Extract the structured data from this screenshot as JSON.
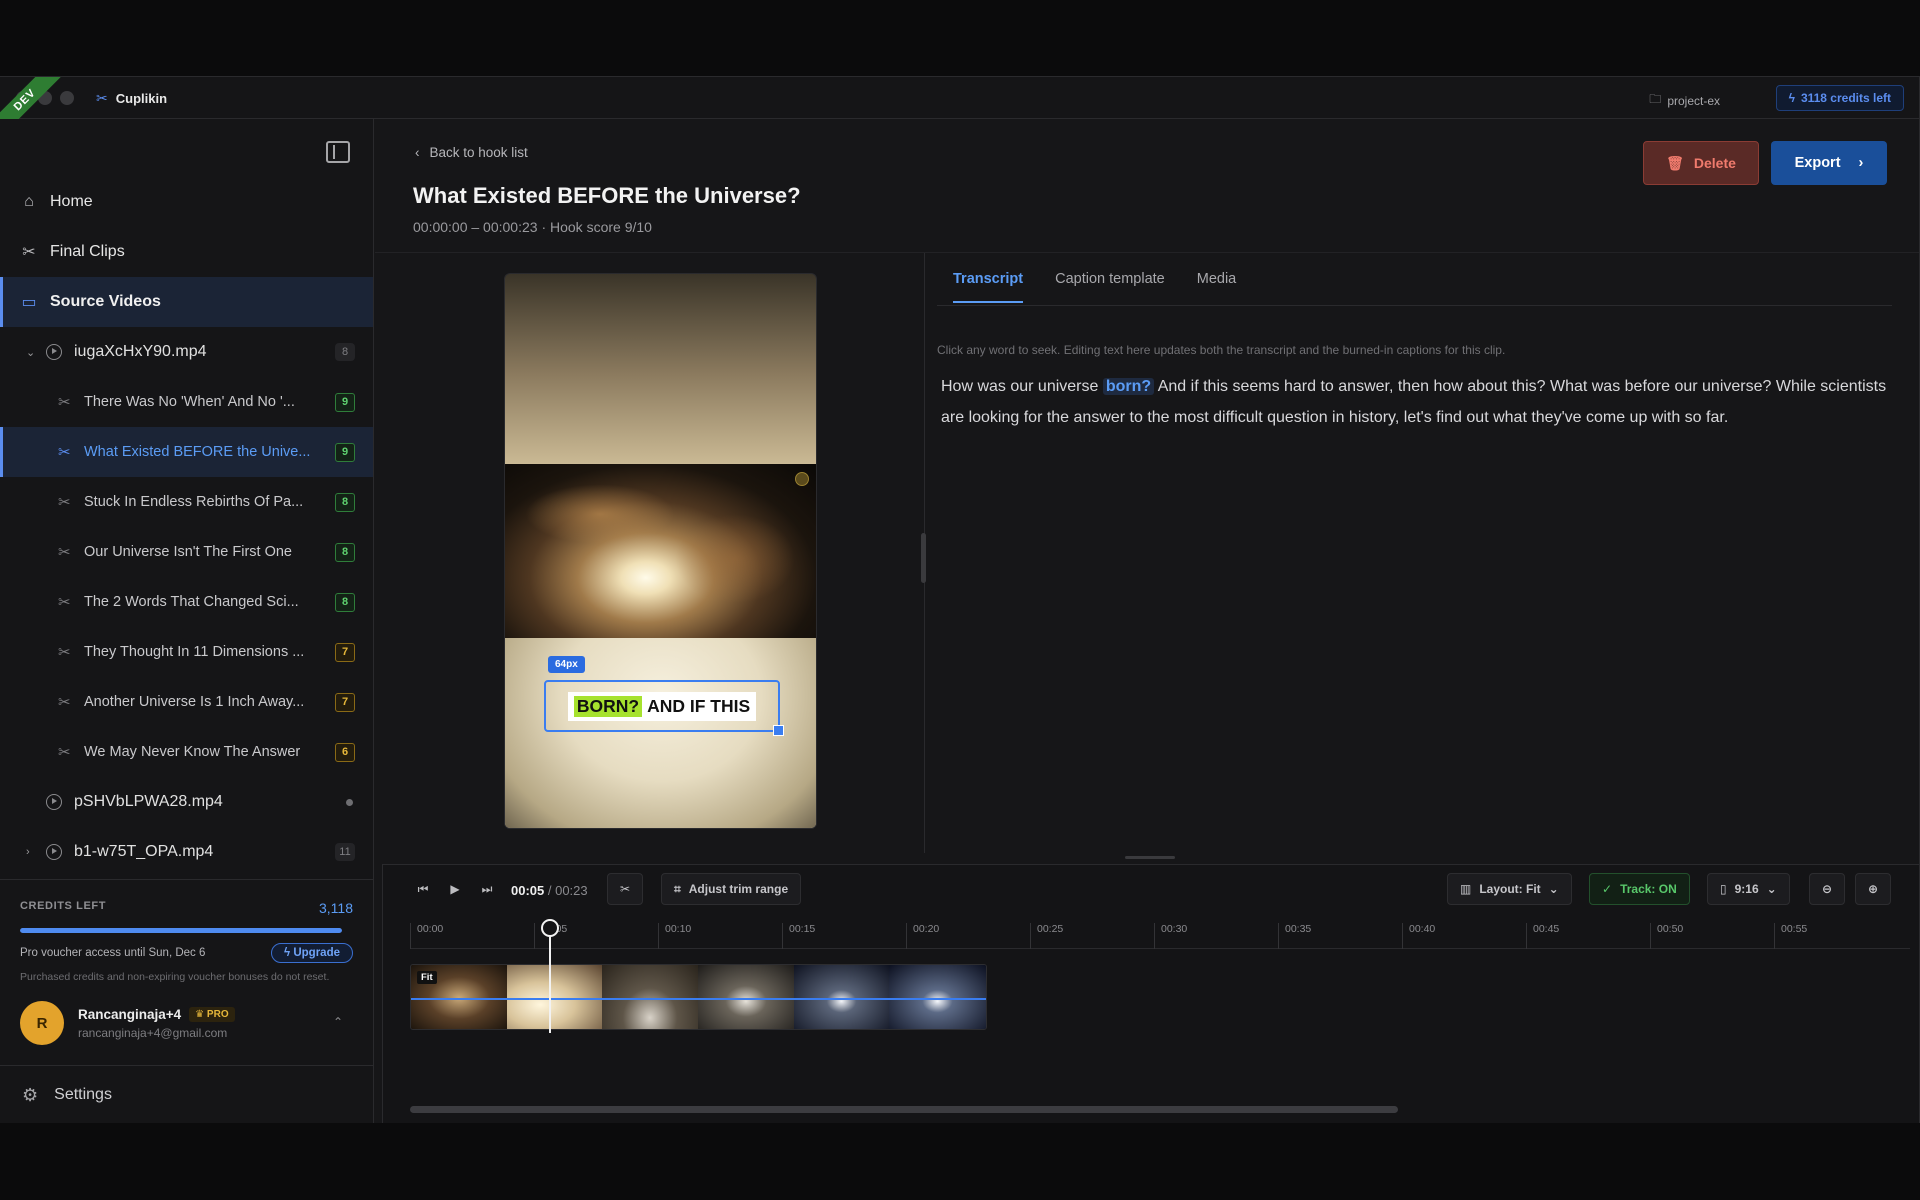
{
  "window": {
    "dev_ribbon": "DEV",
    "app_name": "Cuplikin",
    "project": "project-ex",
    "credits_pill": "3118 credits left"
  },
  "sidebar": {
    "nav": [
      {
        "label": "Home",
        "icon": "home-icon"
      },
      {
        "label": "Final Clips",
        "icon": "scissors-icon"
      },
      {
        "label": "Source Videos",
        "icon": "source-videos-icon"
      }
    ],
    "source_files": [
      {
        "name": "iugaXcHxY90.mp4",
        "count": "8",
        "expanded": true,
        "clips": [
          {
            "title": "There Was No 'When' And No '...",
            "score": "9",
            "tone": "green"
          },
          {
            "title": "What Existed BEFORE the Unive...",
            "score": "9",
            "tone": "green"
          },
          {
            "title": "Stuck In Endless Rebirths Of Pa...",
            "score": "8",
            "tone": "green"
          },
          {
            "title": "Our Universe Isn't The First One",
            "score": "8",
            "tone": "green"
          },
          {
            "title": "The 2 Words That Changed Sci...",
            "score": "8",
            "tone": "green"
          },
          {
            "title": "They Thought In 11 Dimensions ...",
            "score": "7",
            "tone": "amber"
          },
          {
            "title": "Another Universe Is 1 Inch Away...",
            "score": "7",
            "tone": "amber"
          },
          {
            "title": "We May Never Know The Answer",
            "score": "6",
            "tone": "amber"
          }
        ]
      },
      {
        "name": "pSHVbLPWA28.mp4"
      },
      {
        "name": "b1-w75T_OPA.mp4",
        "count": "11"
      }
    ],
    "credits": {
      "label": "CREDITS LEFT",
      "value": "3,118",
      "progress": 1.0,
      "voucher": "Pro voucher access until Sun, Dec 6",
      "upgrade_label": "Upgrade",
      "note": "Purchased credits and non-expiring voucher bonuses do not reset."
    },
    "user": {
      "initial": "R",
      "name": "Rancanginaja+4",
      "badge": "PRO",
      "email": "rancanginaja+4@gmail.com"
    },
    "settings_label": "Settings"
  },
  "header": {
    "back_label": "Back to hook list",
    "title": "What Existed BEFORE the Universe?",
    "subtitle": "00:00:00 – 00:00:23 · Hook score 9/10",
    "delete_label": "Delete",
    "export_label": "Export"
  },
  "preview": {
    "size_tag": "64px",
    "caption_highlight": "BORN?",
    "caption_rest": "AND IF THIS"
  },
  "tabs": [
    {
      "label": "Transcript",
      "active": true
    },
    {
      "label": "Caption template",
      "active": false
    },
    {
      "label": "Media",
      "active": false
    }
  ],
  "transcript": {
    "hint": "Click any word to seek. Editing text here updates both the transcript and the burned-in captions for this clip.",
    "before": "How was our universe ",
    "highlight": "born?",
    "after": " And if this seems hard to answer, then how about this? What was before our universe? While scientists are looking for the answer to the most difficult question in history, let's find out what they've come up with so far."
  },
  "timeline": {
    "current": "00:05",
    "duration": "/ 00:23",
    "trim_label": "Adjust trim range",
    "layout_label": "Layout: Fit",
    "track_label": "Track: ON",
    "ratio_label": "9:16",
    "ticks": [
      "00:00",
      "00:05",
      "00:10",
      "00:15",
      "00:20",
      "00:25",
      "00:30",
      "00:35",
      "00:40",
      "00:45",
      "00:50",
      "00:55"
    ],
    "fit_tag": "Fit"
  }
}
